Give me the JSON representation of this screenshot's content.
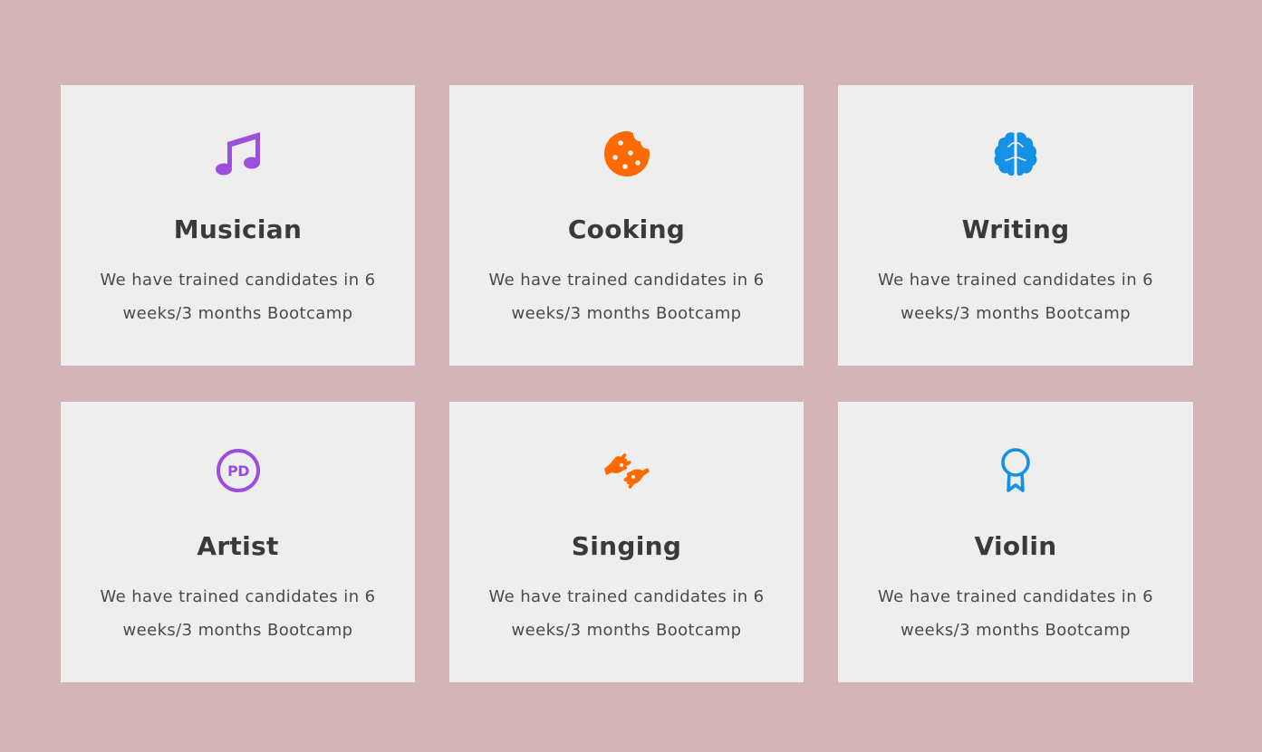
{
  "colors": {
    "background": "#d3b5b7",
    "card": "#eeeeee",
    "purple": "#9b4fdc",
    "orange": "#ff6a00",
    "blue": "#1592e6"
  },
  "cards": [
    {
      "icon": "music-note-icon",
      "title": "Musician",
      "description": "We have trained candidates in 6 weeks/3 months Bootcamp"
    },
    {
      "icon": "cookie-icon",
      "title": "Cooking",
      "description": "We have trained candidates in 6 weeks/3 months Bootcamp"
    },
    {
      "icon": "brain-icon",
      "title": "Writing",
      "description": "We have trained candidates in 6 weeks/3 months Bootcamp"
    },
    {
      "icon": "public-domain-icon",
      "title": "Artist",
      "description": "We have trained candidates in 6 weeks/3 months Bootcamp"
    },
    {
      "icon": "sign-language-icon",
      "title": "Singing",
      "description": "We have trained candidates in 6 weeks/3 months Bootcamp"
    },
    {
      "icon": "award-ribbon-icon",
      "title": "Violin",
      "description": "We have trained candidates in 6 weeks/3 months Bootcamp"
    }
  ]
}
